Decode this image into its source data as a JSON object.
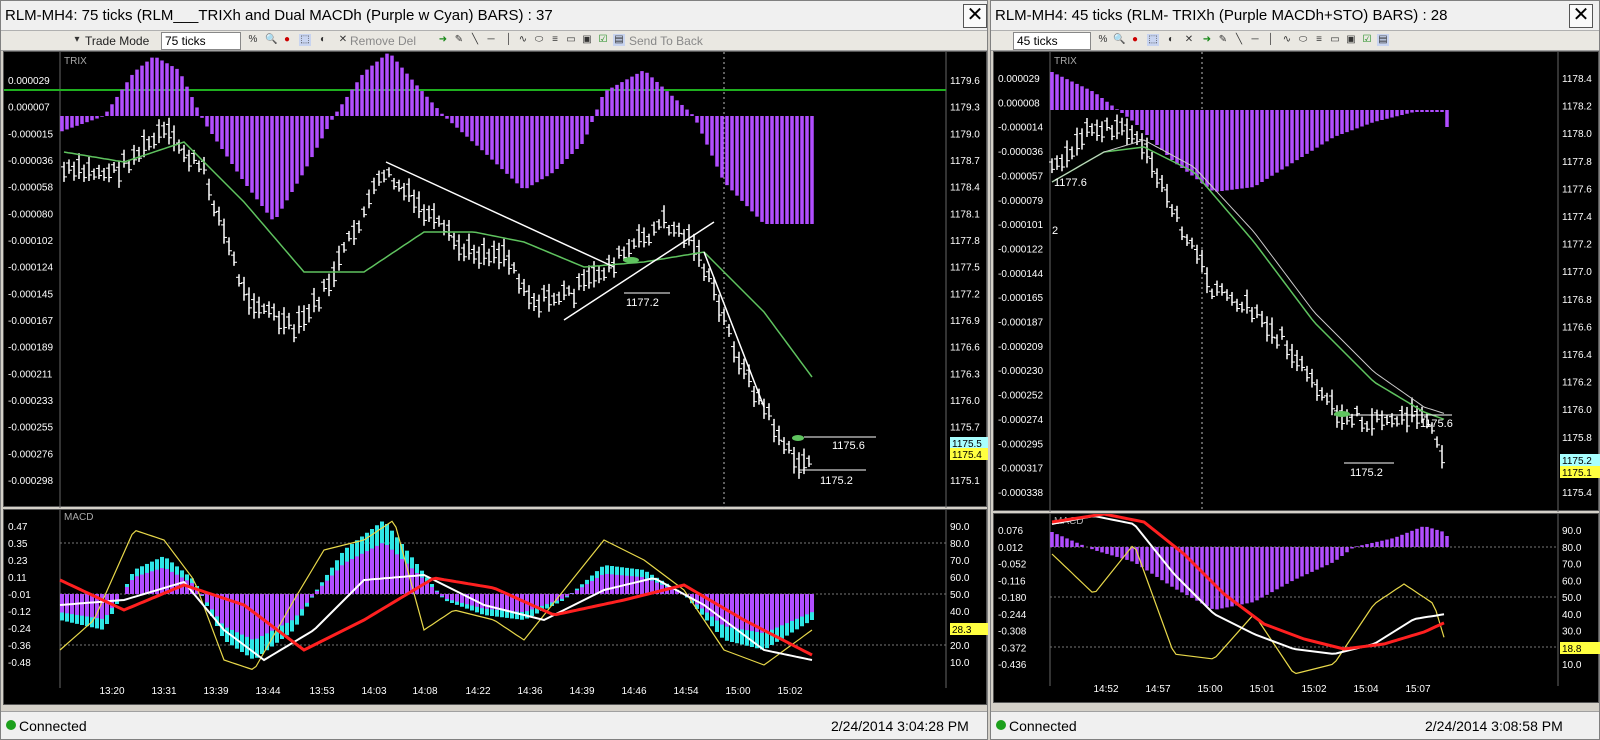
{
  "left_window": {
    "title": "RLM-MH4: 75 ticks (RLM___TRIXh and Dual  MACDh (Purple w Cyan) BARS) : 37",
    "close_label": "✕",
    "toolbar": {
      "trade_mode": "Trade Mode",
      "interval": "75 ticks",
      "remove_del": "Remove Del",
      "send_to_back": "Send To Back"
    },
    "trix_panel": {
      "label": "TRIX",
      "left_axis": [
        "0.000029",
        "0.000007",
        "-0.000015",
        "-0.000036",
        "-0.000058",
        "-0.000080",
        "-0.000102",
        "-0.000124",
        "-0.000145",
        "-0.000167",
        "-0.000189",
        "-0.000211",
        "-0.000233",
        "-0.000255",
        "-0.000276",
        "-0.000298"
      ],
      "right_axis": [
        "1179.6",
        "1179.3",
        "1179.0",
        "1178.7",
        "1178.4",
        "1178.1",
        "1177.8",
        "1177.5",
        "1177.2",
        "1176.9",
        "1176.6",
        "1176.3",
        "1176.0",
        "1175.7",
        "1175.4",
        "1175.1"
      ],
      "price_tags": [
        "1175.5",
        "1175.4"
      ],
      "annotations": [
        "1177.2",
        "1175.6",
        "1175.2"
      ]
    },
    "macd_panel": {
      "label": "MACD",
      "left_axis": [
        "0.47",
        "0.35",
        "0.23",
        "0.11",
        "-0.01",
        "-0.12",
        "-0.24",
        "-0.36",
        "-0.48"
      ],
      "right_axis": [
        "90.0",
        "80.0",
        "70.0",
        "60.0",
        "50.0",
        "40.0",
        "30.0",
        "20.0",
        "10.0"
      ],
      "value_tag": "28.3",
      "time_axis": [
        "13:20",
        "13:31",
        "13:39",
        "13:44",
        "13:53",
        "14:03",
        "14:08",
        "14:22",
        "14:36",
        "14:39",
        "14:46",
        "14:54",
        "15:00",
        "15:02"
      ]
    },
    "status": {
      "connection": "Connected",
      "timestamp": "2/24/2014 3:04:28 PM"
    }
  },
  "right_window": {
    "title": "RLM-MH4: 45 ticks (RLM-  TRIXh (Purple MACDh+STO) BARS) : 28",
    "close_label": "✕",
    "toolbar": {
      "interval": "45 ticks"
    },
    "trix_panel": {
      "label": "TRIX",
      "left_axis": [
        "0.000029",
        "0.000008",
        "-0.000014",
        "-0.000036",
        "-0.000057",
        "-0.000079",
        "-0.000101",
        "-0.000122",
        "-0.000144",
        "-0.000165",
        "-0.000187",
        "-0.000209",
        "-0.000230",
        "-0.000252",
        "-0.000274",
        "-0.000295",
        "-0.000317",
        "-0.000338"
      ],
      "right_axis": [
        "1178.4",
        "1178.2",
        "1178.0",
        "1177.8",
        "1177.6",
        "1177.4",
        "1177.2",
        "1177.0",
        "1176.8",
        "1176.6",
        "1176.4",
        "1176.2",
        "1176.0",
        "1175.8",
        "1175.6",
        "1175.4"
      ],
      "price_tags": [
        "1175.2",
        "1175.1"
      ],
      "annotations": [
        "1177.6",
        "2",
        "1175.6",
        "1175.2"
      ]
    },
    "macd_panel": {
      "label": "MACD",
      "left_axis": [
        "0.076",
        "0.012",
        "-0.052",
        "-0.116",
        "-0.180",
        "-0.244",
        "-0.308",
        "-0.372",
        "-0.436"
      ],
      "right_axis": [
        "90.0",
        "80.0",
        "70.0",
        "60.0",
        "50.0",
        "40.0",
        "30.0",
        "20.0",
        "10.0"
      ],
      "value_tag": "18.8",
      "time_axis": [
        "14:52",
        "14:57",
        "15:00",
        "15:01",
        "15:02",
        "15:04",
        "15:07"
      ]
    },
    "status": {
      "connection": "Connected",
      "timestamp": "2/24/2014 3:08:58 PM"
    }
  },
  "colors": {
    "background": "#000000",
    "histogram": "#b14dff",
    "cyan": "#2ee6e6",
    "ma_green": "#5fc35f",
    "signal_red": "#ff2020",
    "stoch_yellow": "#e8d84a",
    "price_white": "#ffffff",
    "horizontal_line": "#1fb01f",
    "tag_cyan": "#a8ffff",
    "tag_yellow": "#ffff40"
  }
}
